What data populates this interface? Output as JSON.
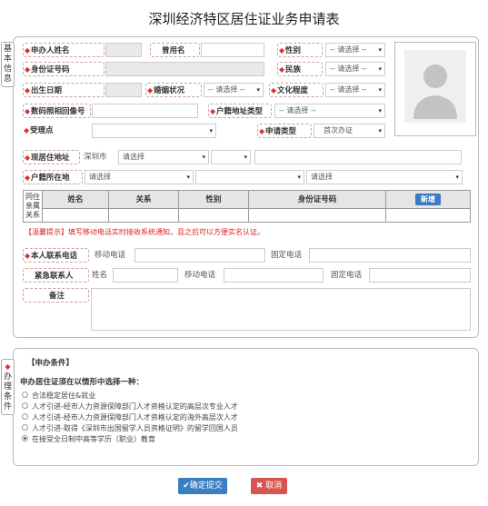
{
  "title": "深圳经济特区居住证业务申请表",
  "tabs": {
    "basic": "基本信息",
    "conditions": "办理条件"
  },
  "fields": {
    "name": "申办人姓名",
    "alias": "曾用名",
    "gender": "性别",
    "id_no": "身份证号码",
    "ethnic": "民族",
    "birth": "出生日期",
    "marital": "婚姻状况",
    "education": "文化程度",
    "photo_receipt": "数码照相回像号",
    "hukou_type": "户籍地址类型",
    "office": "受理点",
    "apply_type": "申请类型",
    "apply_type_value": "首次办证",
    "residence": "现居住地址",
    "residence_city": "深圳市",
    "hukou_loc": "户籍所在地",
    "phone": "本人联系电话",
    "mobile": "移动电话",
    "landline": "固定电话",
    "emergency": "紧急联系人",
    "em_name": "姓名",
    "em_mobile": "移动电话",
    "em_landline": "固定电话",
    "remark": "备注"
  },
  "select_placeholder": "-- 请选择 --",
  "choose": "请选择",
  "family": {
    "side": "同住亲属关系",
    "cols": [
      "姓名",
      "关系",
      "性别",
      "身份证号码"
    ],
    "add": "新增"
  },
  "tip": "【温馨提示】填写移动电话实时接收系统通知，且之后可以方便实名认证。",
  "conditions": {
    "title": "【申办条件】",
    "subtitle": "申办居住证须在以情形中选择一种：",
    "options": [
      {
        "label": "合法稳定居住&就业",
        "selected": false
      },
      {
        "label": "人才引进-经市人力资源保障部门人才资格认定的高层次专业人才",
        "selected": false
      },
      {
        "label": "人才引进-经市人力资源保障部门人才资格认定的海外高层次人才",
        "selected": false
      },
      {
        "label": "人才引进-取得《深圳市出国留学人员资格证明》的留学回国人员",
        "selected": false
      },
      {
        "label": "在接受全日制中高等学历（职业）教育",
        "selected": true
      }
    ]
  },
  "buttons": {
    "submit": "✔确定提交",
    "cancel": "✖ 取消"
  },
  "colors": {
    "submit": "#3a7fc4",
    "cancel": "#d9534f",
    "star": "#dd3333"
  }
}
